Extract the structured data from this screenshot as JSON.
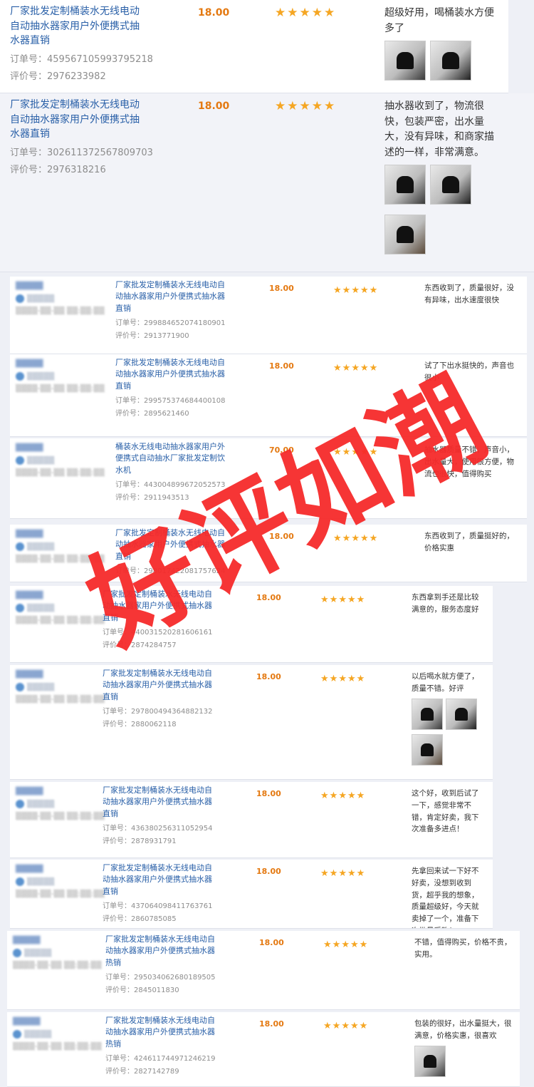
{
  "labels": {
    "order_prefix": "订单号：",
    "review_prefix": "评价号："
  },
  "watermark": {
    "text": "好评如潮",
    "color": "#f52a2a"
  },
  "colors": {
    "link": "#2a60a8",
    "price": "#e47911",
    "star": "#f5a623"
  },
  "reviews": [
    {
      "title": "厂家批发定制桶装水无线电动自动抽水器家用户外便携式抽水器直销",
      "order": "459567105993795218",
      "review": "2976233982",
      "price": "18.00",
      "rating": 5,
      "comment": "超级好用，喝桶装水方便多了",
      "images": [
        "product-photo",
        "product-photo"
      ]
    },
    {
      "title": "厂家批发定制桶装水无线电动自动抽水器家用户外便携式抽水器直销",
      "order": "302611372567809703",
      "review": "2976318216",
      "price": "18.00",
      "rating": 5,
      "comment": "抽水器收到了，物流很快，包装严密，出水量大，没有异味，和商家描述的一样，非常满意。",
      "images": [
        "product-photo",
        "product-photo",
        "product-photo"
      ]
    },
    {
      "title": "厂家批发定制桶装水无线电动自动抽水器家用户外便携式抽水器直销",
      "order": "299884652074180901",
      "review": "2913771900",
      "price": "18.00",
      "rating": 5,
      "comment": "东西收到了，质量很好，没有异味，出水速度很快",
      "images": []
    },
    {
      "title": "厂家批发定制桶装水无线电动自动抽水器家用户外便携式抽水器直销",
      "order": "299575374684400108",
      "review": "2895621460",
      "price": "18.00",
      "rating": 5,
      "comment": "试了下出水挺快的，声音也很小",
      "images": []
    },
    {
      "title": "桶装水无线电动抽水器家用户外便携式自动抽水厂家批发定制饮水机",
      "order": "443004899672052573",
      "review": "2911943513",
      "price": "70.00",
      "rating": 5,
      "comment": "抽水器质量不错，声音小，出水量大，使用很方便，物流也很快，值得购买",
      "images": []
    },
    {
      "title": "厂家批发定制桶装水无线电动自动抽水器家用户外便携式抽水器直销",
      "order": "298017422081757624",
      "review": "",
      "price": "18.00",
      "rating": 5,
      "comment": "东西收到了，质量挺好的，价格实惠",
      "images": []
    },
    {
      "title": "厂家批发定制桶装水无线电动自动抽水器家用户外便携式抽水器直销",
      "order": "440031520281606161",
      "review": "2874284757",
      "price": "18.00",
      "rating": 5,
      "comment": "东西拿到手还是比较满意的，服务态度好",
      "images": []
    },
    {
      "title": "厂家批发定制桶装水无线电动自动抽水器家用户外便携式抽水器直销",
      "order": "297800494364882132",
      "review": "2880062118",
      "price": "18.00",
      "rating": 5,
      "comment": "以后喝水就方便了，质量不错。好评",
      "images": [
        "product-photo",
        "product-photo",
        "product-photo"
      ]
    },
    {
      "title": "厂家批发定制桶装水无线电动自动抽水器家用户外便携式抽水器直销",
      "order": "436380256311052954",
      "review": "2878931791",
      "price": "18.00",
      "rating": 5,
      "comment": "这个好，收到后试了一下，感觉非常不错，肯定好卖，我下次准备多进点！",
      "images": []
    },
    {
      "title": "厂家批发定制桶装水无线电动自动抽水器家用户外便携式抽水器直销",
      "order": "437064098411763761",
      "review": "2860785085",
      "price": "18.00",
      "rating": 5,
      "comment": "先拿回来试一下好不好卖，没想到收到货，超乎我的想象，质量超级好，今天就卖掉了一个，准备下次批量采购！",
      "images": []
    },
    {
      "title": "厂家批发定制桶装水无线电动自动抽水器家用户外便携式抽水器热销",
      "order": "295034062680189505",
      "review": "2845011830",
      "price": "18.00",
      "rating": 5,
      "comment": "不错，值得购买，价格不贵，实用。",
      "images": []
    },
    {
      "title": "厂家批发定制桶装水无线电动自动抽水器家用户外便携式抽水器热销",
      "order": "424611744971246219",
      "review": "2827142789",
      "price": "18.00",
      "rating": 5,
      "comment": "包装的很好，出水量挺大，很满意，价格实惠，很喜欢",
      "images": [
        "product-photo"
      ]
    }
  ]
}
